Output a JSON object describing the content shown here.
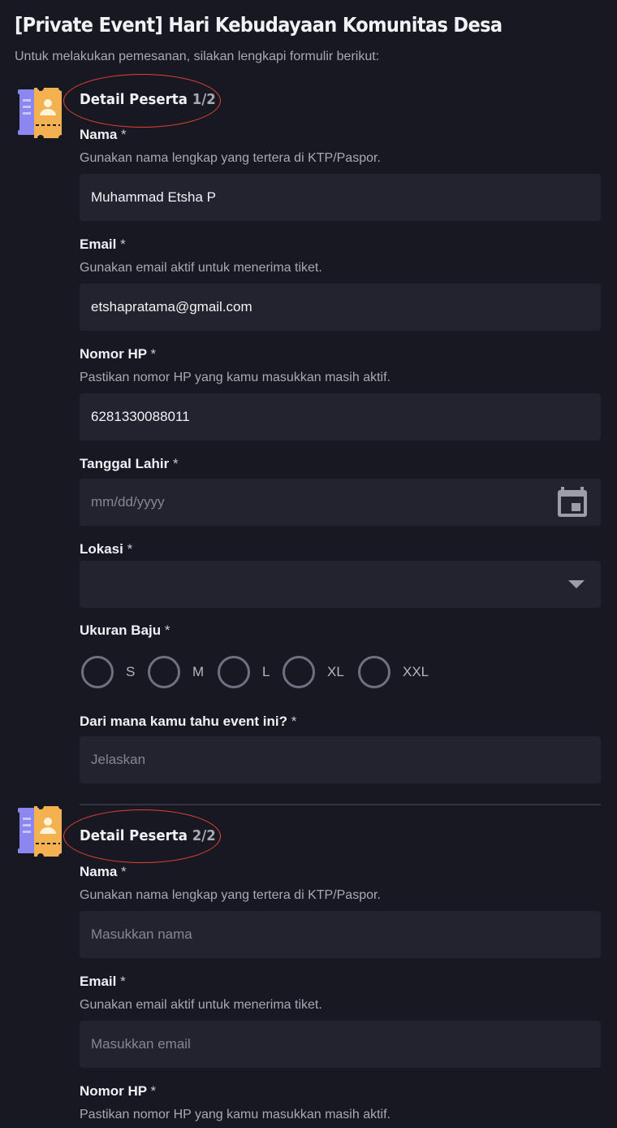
{
  "header": {
    "title": "[Private Event] Hari Kebudayaan Komunitas Desa",
    "subtitle": "Untuk melakukan pemesanan, silakan lengkapi formulir berikut:"
  },
  "participant1": {
    "title": "Detail Peserta",
    "counter": "1/2",
    "icon": "ticket-icon",
    "nama": {
      "label": "Nama",
      "required": "*",
      "hint": "Gunakan nama lengkap yang tertera di KTP/Paspor.",
      "value": "Muhammad Etsha P"
    },
    "email": {
      "label": "Email",
      "required": "*",
      "hint": "Gunakan email aktif untuk menerima tiket.",
      "value": "etshapratama@gmail.com"
    },
    "phone": {
      "label": "Nomor HP",
      "required": "*",
      "hint": "Pastikan nomor HP yang kamu masukkan masih aktif.",
      "value": "6281330088011"
    },
    "birthdate": {
      "label": "Tanggal Lahir",
      "required": "*",
      "placeholder": "mm/dd/yyyy",
      "icon": "calendar-icon"
    },
    "location": {
      "label": "Lokasi",
      "required": "*",
      "selected": "",
      "icon": "dropdown-arrow-icon"
    },
    "shirt_size": {
      "label": "Ukuran Baju",
      "required": "*",
      "options": [
        "S",
        "M",
        "L",
        "XL",
        "XXL"
      ],
      "selected": null
    },
    "source": {
      "label": "Dari mana kamu tahu event ini?",
      "required": "*",
      "placeholder": "Jelaskan"
    }
  },
  "participant2": {
    "title": "Detail Peserta",
    "counter": "2/2",
    "icon": "ticket-icon",
    "nama": {
      "label": "Nama",
      "required": "*",
      "hint": "Gunakan nama lengkap yang tertera di KTP/Paspor.",
      "placeholder": "Masukkan nama"
    },
    "email": {
      "label": "Email",
      "required": "*",
      "hint": "Gunakan email aktif untuk menerima tiket.",
      "placeholder": "Masukkan email"
    },
    "phone": {
      "label": "Nomor HP",
      "required": "*",
      "hint": "Pastikan nomor HP yang kamu masukkan masih aktif."
    }
  },
  "colors": {
    "background": "#181823",
    "input_background": "#23232f",
    "annotation_circle": "#e0432f",
    "ticket_purple": "#8b86f0",
    "ticket_orange": "#f4b14f"
  }
}
